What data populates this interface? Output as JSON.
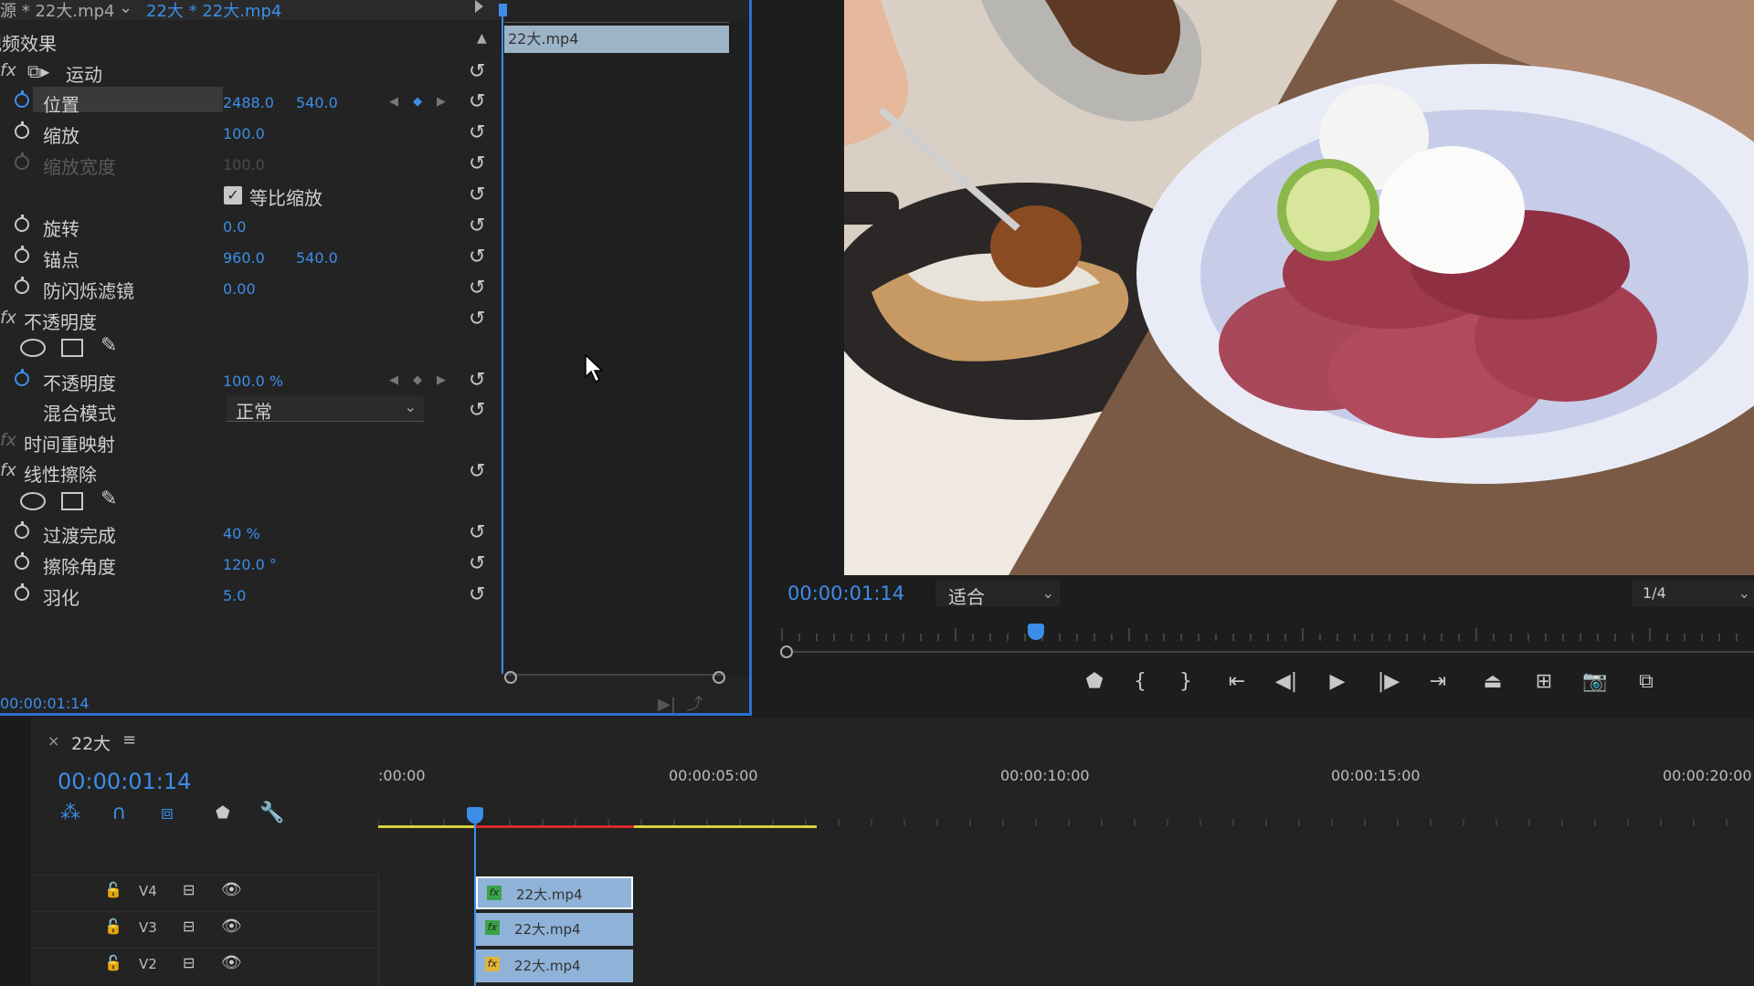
{
  "effect_controls": {
    "source_label": "源 * 22大.mp4",
    "sequence_label": "22大 * 22大.mp4",
    "section_title": "视频效果",
    "clip_name": "22大.mp4",
    "bottom_time": "00:00:01:14",
    "motion": {
      "title": "运动",
      "position": {
        "label": "位置",
        "x": "2488.0",
        "y": "540.0"
      },
      "scale": {
        "label": "缩放",
        "value": "100.0"
      },
      "scale_width": {
        "label": "缩放宽度",
        "value": "100.0"
      },
      "uniform_scale": {
        "label": "等比缩放",
        "checked": true
      },
      "rotation": {
        "label": "旋转",
        "value": "0.0"
      },
      "anchor": {
        "label": "锚点",
        "x": "960.0",
        "y": "540.0"
      },
      "anti_flicker": {
        "label": "防闪烁滤镜",
        "value": "0.00"
      }
    },
    "opacity": {
      "title": "不透明度",
      "opacity": {
        "label": "不透明度",
        "value": "100.0 %"
      },
      "blend": {
        "label": "混合模式",
        "value": "正常"
      }
    },
    "time_remap": {
      "title": "时间重映射"
    },
    "linear_wipe": {
      "title": "线性擦除",
      "completion": {
        "label": "过渡完成",
        "value": "40 %"
      },
      "angle": {
        "label": "擦除角度",
        "value": "120.0 °"
      },
      "feather": {
        "label": "羽化",
        "value": "5.0"
      }
    }
  },
  "program_monitor": {
    "timecode": "00:00:01:14",
    "fit": "适合",
    "resolution": "1/4",
    "transport_icons": [
      "marker-icon",
      "mark-in-icon",
      "mark-out-icon",
      "go-to-in-icon",
      "step-back-icon",
      "play-icon",
      "step-forward-icon",
      "go-to-out-icon",
      "lift-icon",
      "extract-icon",
      "camera-icon",
      "compare-icon"
    ]
  },
  "timeline": {
    "tab_name": "22大",
    "timecode": "00:00:01:14",
    "ruler_labels": [
      ":00:00",
      "00:00:05:00",
      "00:00:10:00",
      "00:00:15:00",
      "00:00:20:00"
    ],
    "tracks": [
      {
        "name": "V4",
        "clip": "22大.mp4",
        "badge": "green",
        "selected": true
      },
      {
        "name": "V3",
        "clip": "22大.mp4",
        "badge": "green",
        "selected": false
      },
      {
        "name": "V2",
        "clip": "22大.mp4",
        "badge": "yellow",
        "selected": false
      }
    ]
  },
  "colors": {
    "accent": "#3d8ee8",
    "clip": "#8fb2d8",
    "work_area": "#d8d23a",
    "render_red": "#d62a2a"
  }
}
